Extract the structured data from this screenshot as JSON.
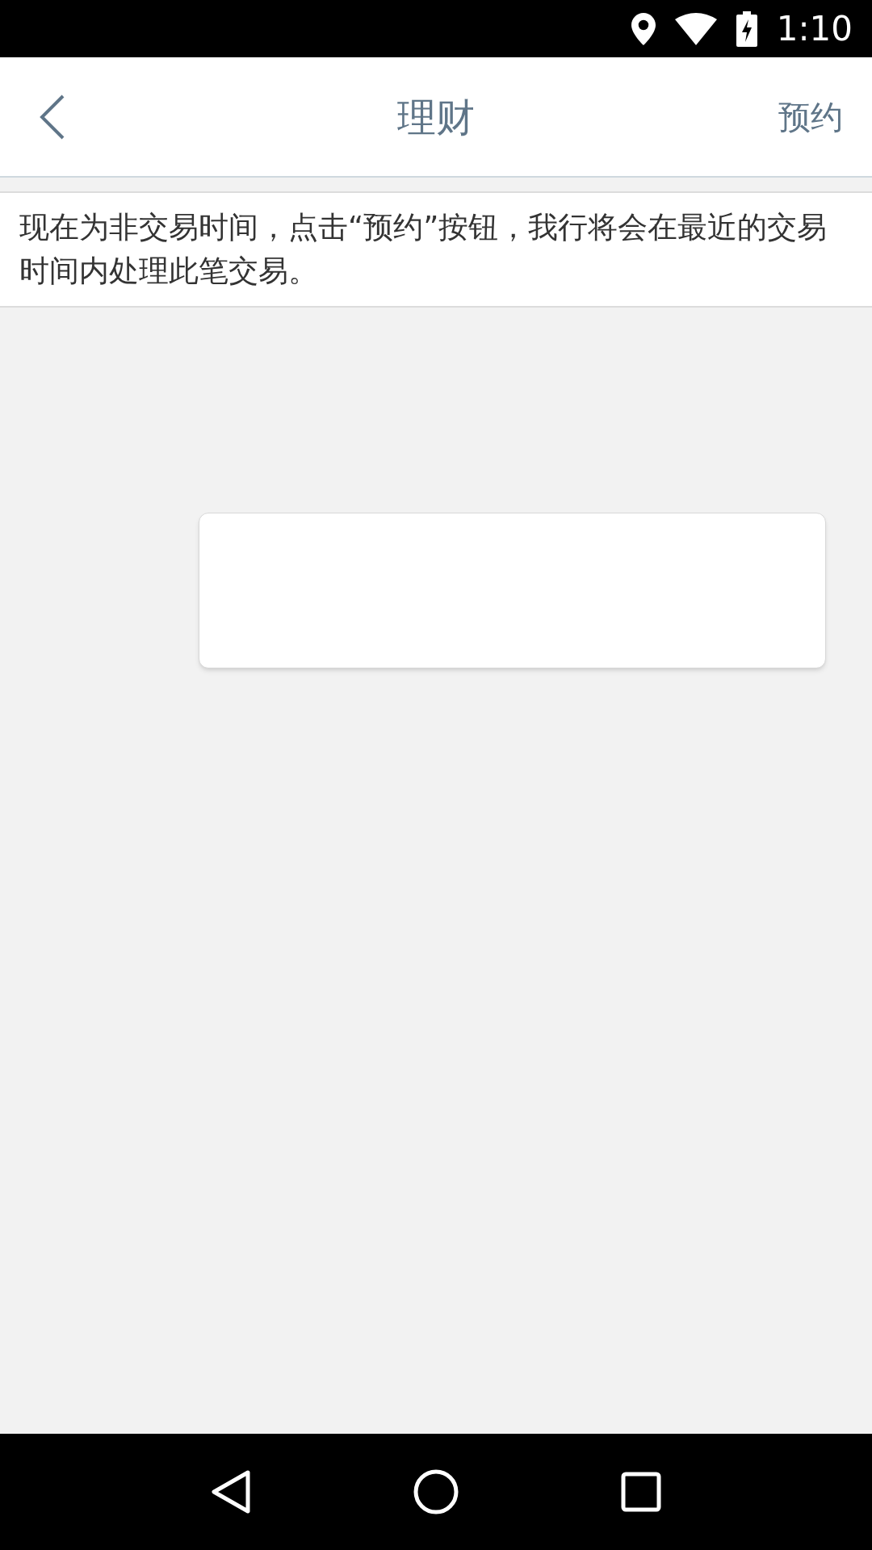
{
  "status_bar": {
    "time": "1:10",
    "charging": true
  },
  "header": {
    "title": "理财",
    "action": "预约"
  },
  "notice": {
    "text": "现在为非交易时间，点击“预约”按钮，我行将会在最近的交易时间内处理此笔交易。"
  },
  "card": {
    "kind": "empty"
  }
}
